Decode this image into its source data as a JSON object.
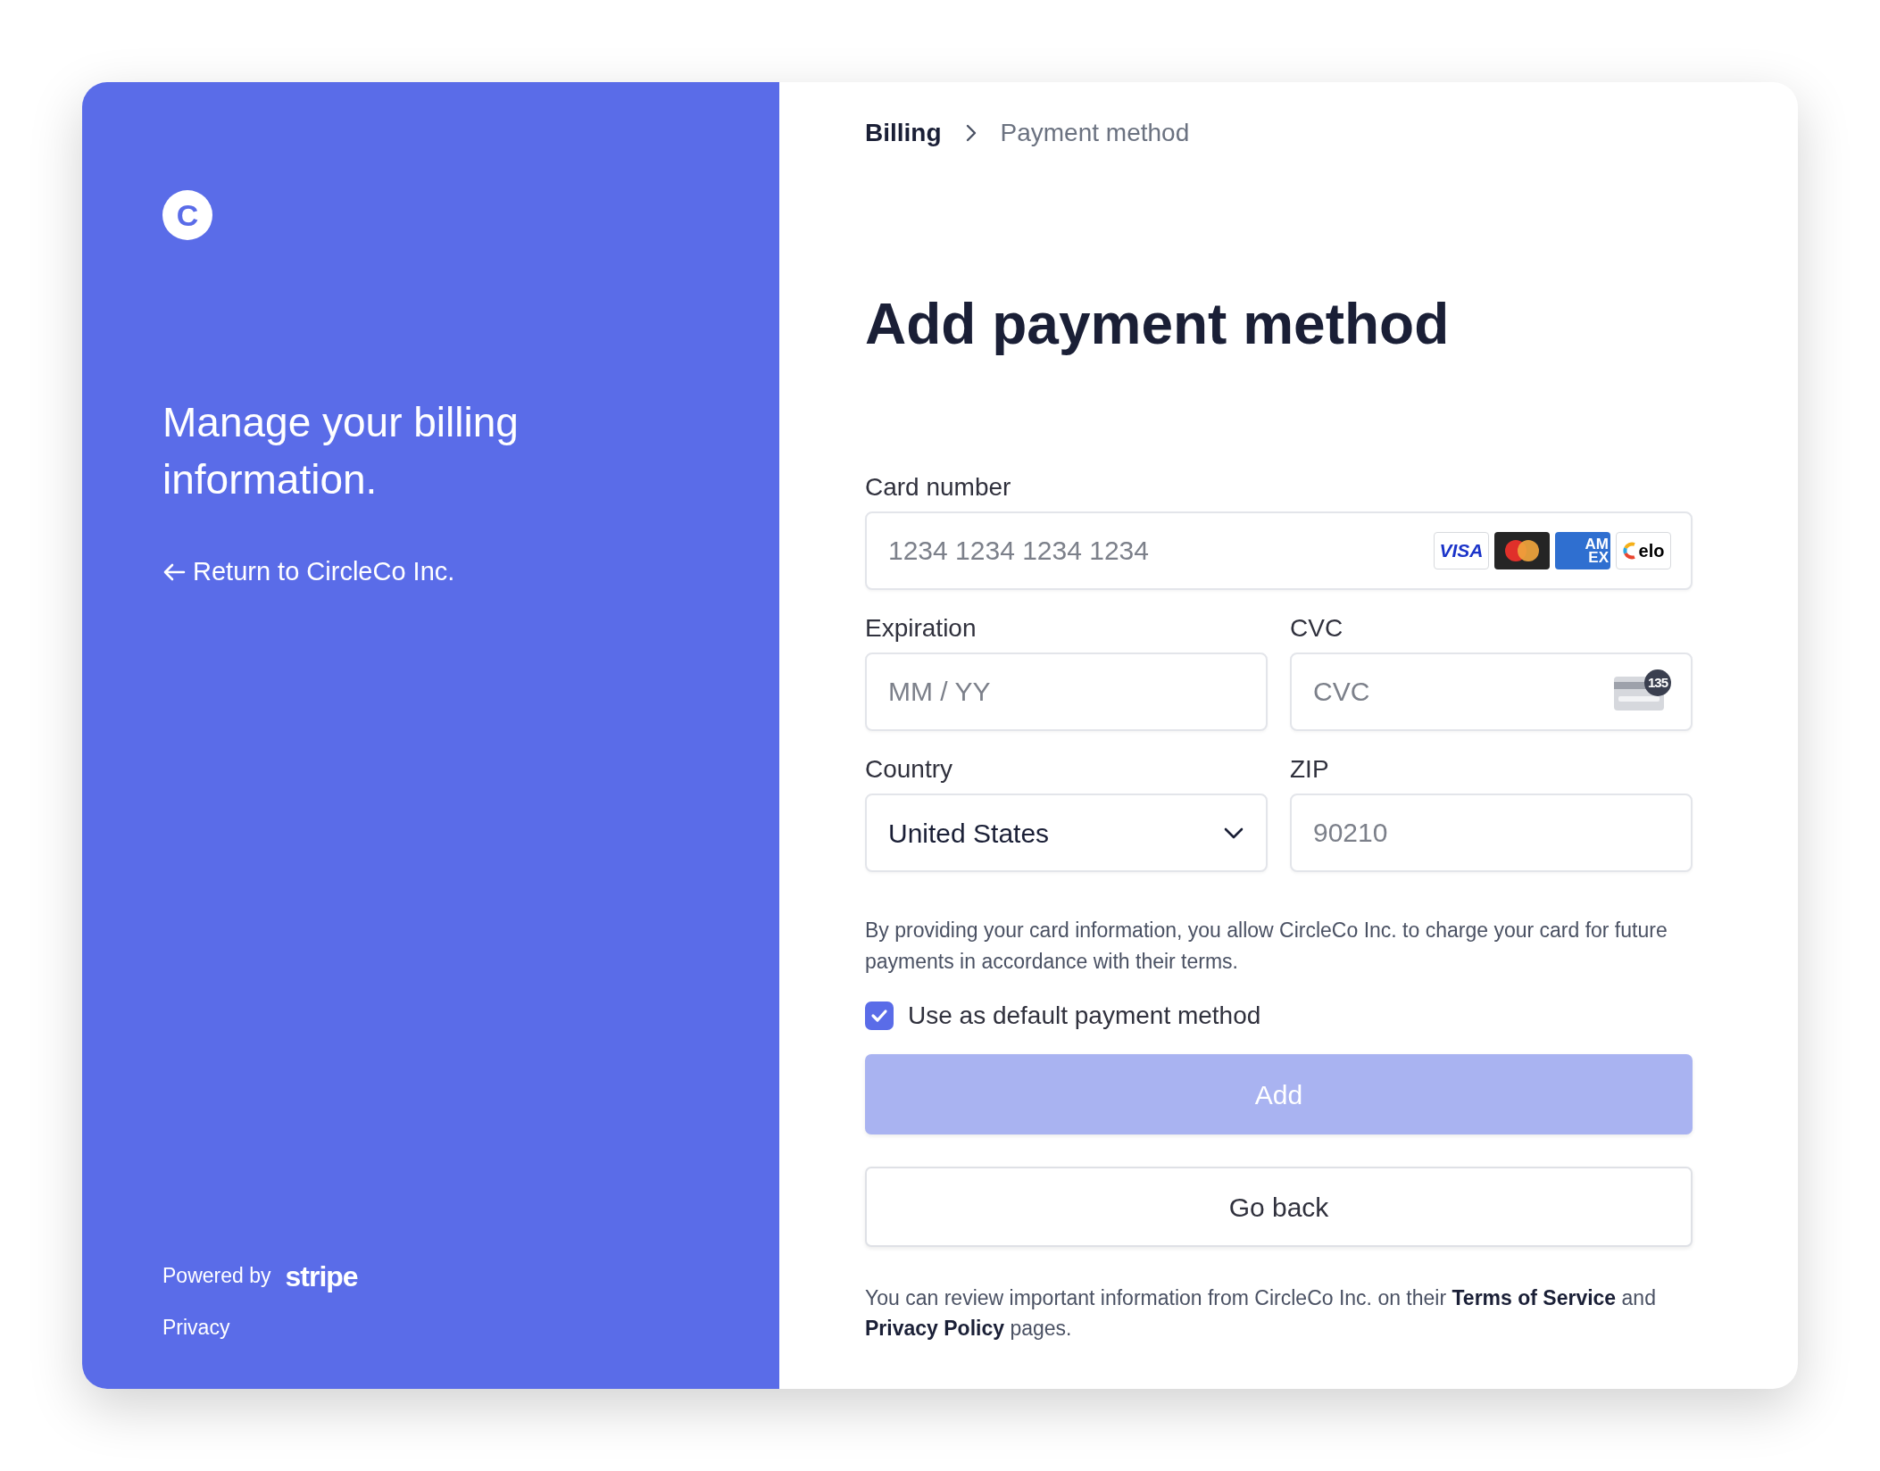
{
  "brand": {
    "logo_letter": "C",
    "tagline": "Manage your billing information.",
    "return_link": "Return to CircleCo Inc.",
    "powered_by": "Powered by",
    "powered_brand": "stripe",
    "privacy_link": "Privacy"
  },
  "breadcrumb": [
    {
      "label": "Billing",
      "current": false
    },
    {
      "label": "Payment method",
      "current": true
    }
  ],
  "title": "Add payment method",
  "fields": [
    {
      "kind": "card",
      "label": "Card number",
      "placeholder": "1234 1234 1234 1234",
      "brands": [
        {
          "kind": "visa",
          "text": "VISA"
        },
        {
          "kind": "mastercard"
        },
        {
          "kind": "amex",
          "lines": [
            "AM",
            "EX"
          ]
        },
        {
          "kind": "elo",
          "text": "elo"
        }
      ]
    },
    {
      "kind": "text",
      "label": "Expiration",
      "placeholder": "MM / YY"
    },
    {
      "kind": "cvc",
      "label": "CVC",
      "placeholder": "CVC",
      "badge": "135"
    },
    {
      "kind": "select",
      "label": "Country",
      "value": "United States"
    },
    {
      "kind": "text",
      "label": "ZIP",
      "placeholder": "90210"
    }
  ],
  "consent": "By providing your card information, you allow CircleCo Inc. to charge your card for future payments in accordance with their terms.",
  "default_checkbox": {
    "label": "Use as default payment method",
    "checked": true
  },
  "buttons": [
    {
      "kind": "primary",
      "label": "Add",
      "disabled": true
    },
    {
      "kind": "secondary",
      "label": "Go back",
      "disabled": false
    }
  ],
  "footer": [
    {
      "kind": "text",
      "text": "You can review important information from CircleCo Inc. on their "
    },
    {
      "kind": "link",
      "text": "Terms of Service"
    },
    {
      "kind": "text",
      "text": " and "
    },
    {
      "kind": "link",
      "text": "Privacy Policy"
    },
    {
      "kind": "text",
      "text": " pages."
    }
  ]
}
